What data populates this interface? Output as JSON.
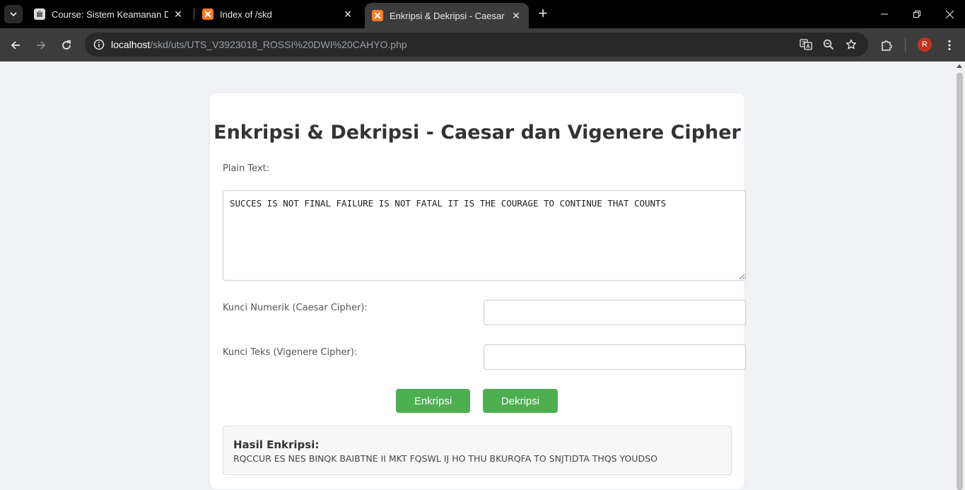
{
  "browser": {
    "tabs": [
      {
        "title": "Course: Sistem Keamanan Data",
        "favicon": "moodle-icon",
        "active": false
      },
      {
        "title": "Index of /skd",
        "favicon": "xampp-icon",
        "active": false
      },
      {
        "title": "Enkripsi & Dekripsi - Caesar dan Vigenere Cipher",
        "favicon": "xampp-icon",
        "active": true
      }
    ],
    "url_host": "localhost",
    "url_path": "/skd/uts/UTS_V3923018_ROSSI%20DWI%20CAHYO.php",
    "profile_initial": "R",
    "colors": {
      "tabstrip": "#000000",
      "toolbar": "#3c3c3c",
      "omnibox": "#282828",
      "avatar": "#c5321d"
    }
  },
  "page": {
    "title": "Enkripsi & Dekripsi - Caesar dan Vigenere Cipher",
    "plain_text_label": "Plain Text:",
    "plain_text_value": "SUCCES IS NOT FINAL FAILURE IS NOT FATAL IT IS THE COURAGE TO CONTINUE THAT COUNTS",
    "caesar_key_label": "Kunci Numerik (Caesar Cipher):",
    "caesar_key_value": "",
    "vigenere_key_label": "Kunci Teks (Vigenere Cipher):",
    "vigenere_key_value": "",
    "encrypt_button": "Enkripsi",
    "decrypt_button": "Dekripsi",
    "result_title": "Hasil Enkripsi:",
    "result_value": "RQCCUR ES NES BINQK BAIBTNE II MKT FQSWL IJ HO THU BKURQFA TO SNJTIDTA THQS YOUDSO",
    "colors": {
      "background": "#f0f2f5",
      "card": "#ffffff",
      "button": "#4caf50",
      "result_bg": "#f7f7f7"
    }
  }
}
